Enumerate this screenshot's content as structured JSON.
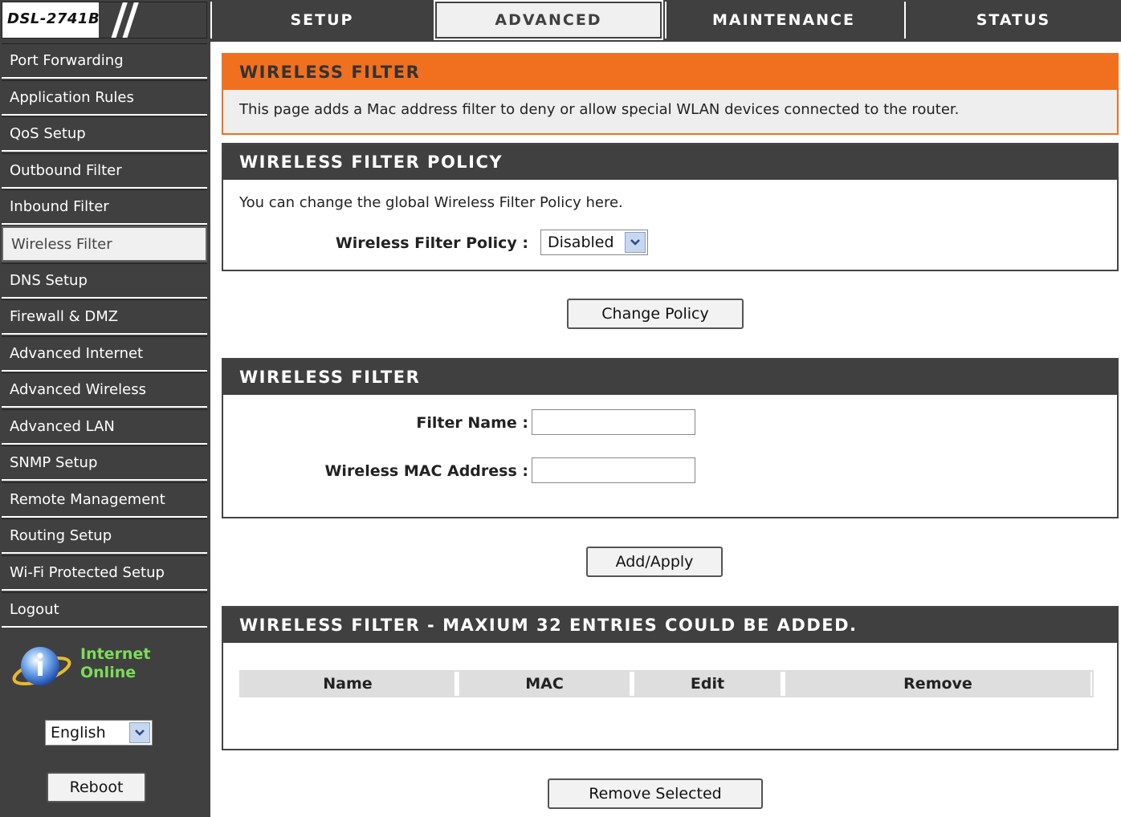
{
  "header": {
    "model": "DSL-2741B",
    "tabs": [
      {
        "label": "SETUP"
      },
      {
        "label": "ADVANCED"
      },
      {
        "label": "MAINTENANCE"
      },
      {
        "label": "STATUS"
      }
    ],
    "active_tab": "ADVANCED"
  },
  "sidebar": {
    "items": [
      {
        "label": "Port Forwarding"
      },
      {
        "label": "Application Rules"
      },
      {
        "label": "QoS Setup"
      },
      {
        "label": "Outbound Filter"
      },
      {
        "label": "Inbound Filter"
      },
      {
        "label": "Wireless Filter"
      },
      {
        "label": "DNS Setup"
      },
      {
        "label": "Firewall & DMZ"
      },
      {
        "label": "Advanced Internet"
      },
      {
        "label": "Advanced Wireless"
      },
      {
        "label": "Advanced LAN"
      },
      {
        "label": "SNMP Setup"
      },
      {
        "label": "Remote Management"
      },
      {
        "label": "Routing Setup"
      },
      {
        "label": "Wi-Fi Protected Setup"
      },
      {
        "label": "Logout"
      }
    ],
    "active_item": "Wireless Filter",
    "internet_status_line1": "Internet",
    "internet_status_line2": "Online",
    "language": "English",
    "reboot_label": "Reboot"
  },
  "intro": {
    "title": "WIRELESS FILTER",
    "description": "This page adds a Mac address filter to deny or allow special WLAN devices connected to the router."
  },
  "policy": {
    "title": "WIRELESS FILTER POLICY",
    "description": "You can change the global Wireless Filter Policy here.",
    "label": "Wireless Filter Policy :",
    "value": "Disabled",
    "button_label": "Change Policy"
  },
  "filter_form": {
    "title": "WIRELESS FILTER",
    "filter_name_label": "Filter Name :",
    "filter_name_value": "",
    "mac_label": "Wireless MAC Address :",
    "mac_value": "",
    "button_label": "Add/Apply"
  },
  "filter_list": {
    "title": "WIRELESS FILTER - MAXIUM 32 ENTRIES COULD BE ADDED.",
    "columns": [
      "Name",
      "MAC",
      "Edit",
      "Remove"
    ],
    "remove_button_label": "Remove Selected"
  },
  "colors": {
    "dark": "#404040",
    "accent_orange": "#f07020",
    "status_green": "#7ddc5a"
  }
}
